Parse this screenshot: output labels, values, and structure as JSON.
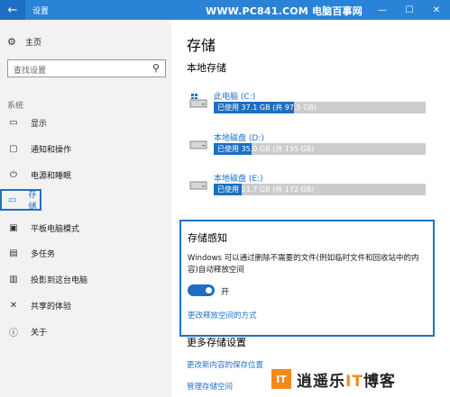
{
  "window": {
    "title": "设置",
    "watermark": "WWW.PC841.COM 电脑百事网",
    "back_glyph": "←",
    "min_glyph": "—",
    "max_glyph": "☐",
    "close_glyph": "✕"
  },
  "sidebar": {
    "home_label": "主页",
    "search_placeholder": "查找设置",
    "section_label": "系统",
    "items": [
      {
        "label": "显示",
        "icon": "display-icon"
      },
      {
        "label": "通知和操作",
        "icon": "notification-icon"
      },
      {
        "label": "电源和睡眠",
        "icon": "power-icon"
      },
      {
        "label": "存储",
        "icon": "storage-icon",
        "active": true
      },
      {
        "label": "平板电脑模式",
        "icon": "tablet-icon"
      },
      {
        "label": "多任务",
        "icon": "multitask-icon"
      },
      {
        "label": "投影到这台电脑",
        "icon": "project-icon"
      },
      {
        "label": "共享的体验",
        "icon": "shared-experience-icon"
      },
      {
        "label": "关于",
        "icon": "info-icon"
      }
    ]
  },
  "main": {
    "title": "存储",
    "local_storage_heading": "本地存储",
    "drives": [
      {
        "name": "此电脑 (C:)",
        "usage": "已使用 37.1 GB (共 97.5 GB)",
        "used_fraction": 0.38,
        "icon": "windows-drive-icon"
      },
      {
        "name": "本地磁盘 (D:)",
        "usage": "已使用 35.0 GB (共 195 GB)",
        "used_fraction": 0.18,
        "icon": "disk-drive-icon"
      },
      {
        "name": "本地磁盘 (E:)",
        "usage": "已使用 21.7 GB (共 172 GB)",
        "used_fraction": 0.13,
        "icon": "disk-drive-icon"
      }
    ],
    "storage_sense": {
      "title": "存储感知",
      "description": "Windows 可以通过删除不需要的文件(例如临时文件和回收站中的内容)自动释放空间",
      "toggle_state": "开",
      "link": "更改释放空间的方式"
    },
    "more_settings": {
      "title": "更多存储设置",
      "link1": "更改新内容的保存位置",
      "link2": "管理存储空间"
    }
  },
  "brand": {
    "logo_text": "IT",
    "name_prefix": "逍遥乐",
    "name_it": "IT",
    "name_suffix": "博客"
  },
  "colors": {
    "accent": "#1d72c8",
    "titlebar": "#2b83d8",
    "bar_fill": "#1d6fc0",
    "bar_track": "#cccccc",
    "brand_orange": "#f28a1a"
  }
}
